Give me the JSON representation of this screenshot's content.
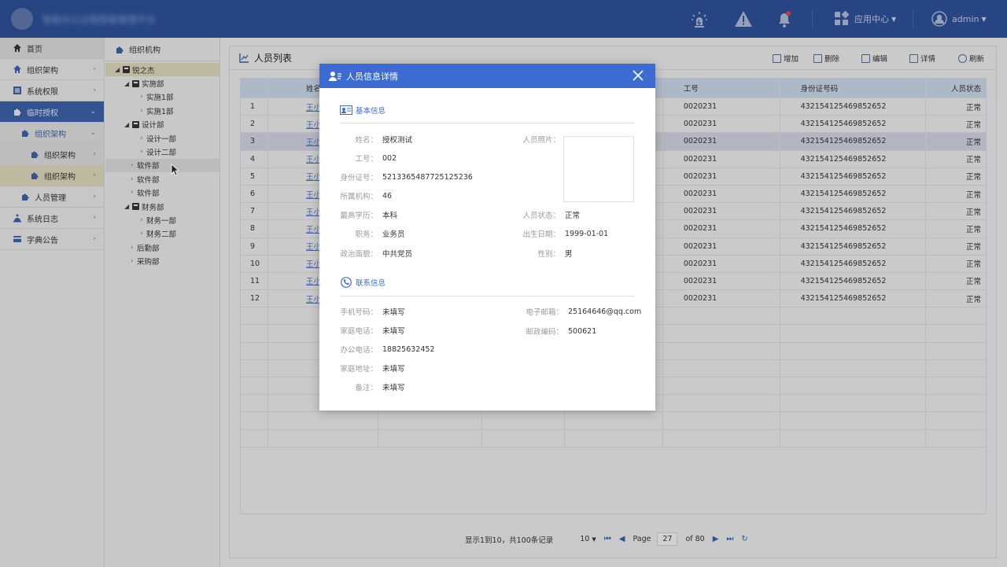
{
  "header": {
    "system_title": "智能办公过程智能管理平台",
    "app_center_label": "应用中心",
    "user_label": "admin"
  },
  "nav": {
    "items": [
      {
        "label": "首页"
      },
      {
        "label": "组织架构"
      },
      {
        "label": "系统权限"
      },
      {
        "label": "临时授权"
      },
      {
        "label": "组织架构"
      },
      {
        "label": "组织架构"
      },
      {
        "label": "组织架构"
      },
      {
        "label": "人员管理"
      },
      {
        "label": "系统日志"
      },
      {
        "label": "字典公告"
      }
    ]
  },
  "tree": {
    "title": "组织机构",
    "nodes": [
      {
        "label": "锐之杰"
      },
      {
        "label": "实施部"
      },
      {
        "label": "实施1部"
      },
      {
        "label": "实施1部"
      },
      {
        "label": "设计部"
      },
      {
        "label": "设计一部"
      },
      {
        "label": "设计二部"
      },
      {
        "label": "软件部"
      },
      {
        "label": "软件部"
      },
      {
        "label": "软件部"
      },
      {
        "label": "财务部"
      },
      {
        "label": "财务一部"
      },
      {
        "label": "财务二部"
      },
      {
        "label": "后勤部"
      },
      {
        "label": "采购部"
      }
    ]
  },
  "main": {
    "title": "人员列表",
    "toolbar": {
      "add": "增加",
      "delete": "删除",
      "edit": "编辑",
      "detail": "详情",
      "refresh": "刷新"
    },
    "columns": {
      "name": "姓名",
      "job_no": "工号",
      "id_no": "身份证号码",
      "status": "人员状态"
    },
    "rows": [
      {
        "n": "1",
        "name": "王小",
        "job": "0020231",
        "id": "432154125469852652",
        "status": "正常"
      },
      {
        "n": "2",
        "name": "王小",
        "job": "0020231",
        "id": "432154125469852652",
        "status": "正常"
      },
      {
        "n": "3",
        "name": "王小",
        "job": "0020231",
        "id": "432154125469852652",
        "status": "正常"
      },
      {
        "n": "4",
        "name": "王小",
        "job": "0020231",
        "id": "432154125469852652",
        "status": "正常"
      },
      {
        "n": "5",
        "name": "王小",
        "job": "0020231",
        "id": "432154125469852652",
        "status": "正常"
      },
      {
        "n": "6",
        "name": "王小",
        "job": "0020231",
        "id": "432154125469852652",
        "status": "正常"
      },
      {
        "n": "7",
        "name": "王小",
        "job": "0020231",
        "id": "432154125469852652",
        "status": "正常"
      },
      {
        "n": "8",
        "name": "王小",
        "job": "0020231",
        "id": "432154125469852652",
        "status": "正常"
      },
      {
        "n": "9",
        "name": "王小",
        "job": "0020231",
        "id": "432154125469852652",
        "status": "正常"
      },
      {
        "n": "10",
        "name": "王小",
        "job": "0020231",
        "id": "432154125469852652",
        "status": "正常"
      },
      {
        "n": "11",
        "name": "王小",
        "job": "0020231",
        "id": "432154125469852652",
        "status": "正常"
      },
      {
        "n": "12",
        "name": "王小",
        "job": "0020231",
        "id": "432154125469852652",
        "status": "正常"
      }
    ],
    "pager": {
      "summary": "显示1到10，共100条记录",
      "page_size": "10",
      "page_label": "Page",
      "page_value": "27",
      "of_label": "of 80"
    }
  },
  "modal": {
    "title": "人员信息详情",
    "basic_section": "基本信息",
    "contact_section": "联系信息",
    "basic": {
      "name_label": "姓名：",
      "name": "授权测试",
      "job_label": "工号：",
      "job": "002",
      "id_label": "身份证号：",
      "id": "5213365487725125236",
      "org_label": "所属机构：",
      "org": "46",
      "edu_label": "最高学历：",
      "edu": "本科",
      "duty_label": "职务：",
      "duty": "业务员",
      "politics_label": "政治面貌：",
      "politics": "中共党员",
      "photo_label": "人员照片：",
      "status_label": "人员状态：",
      "status": "正常",
      "birth_label": "出生日期：",
      "birth": "1999-01-01",
      "gender_label": "性别：",
      "gender": "男"
    },
    "contact": {
      "mobile_label": "手机号码：",
      "mobile": "未填写",
      "home_phone_label": "家庭电话：",
      "home_phone": "未填写",
      "office_phone_label": "办公电话：",
      "office_phone": "18825632452",
      "address_label": "家庭地址：",
      "address": "未填写",
      "remark_label": "备注：",
      "remark": "未填写",
      "email_label": "电子邮箱：",
      "email": "25164646@qq.com",
      "zip_label": "邮政编码：",
      "zip": "500621"
    }
  },
  "colors": {
    "header": "#2c4f95",
    "accent": "#3c6cd1",
    "link": "#4a73c0"
  }
}
